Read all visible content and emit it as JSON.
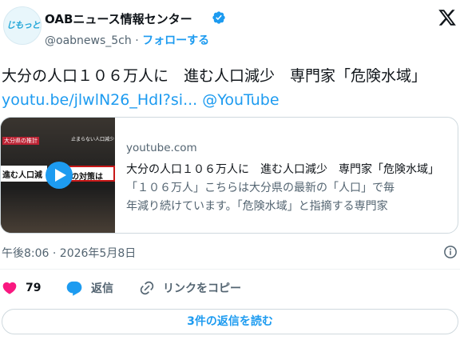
{
  "author": {
    "avatar_text": "じもっと!",
    "display_name": "OABニュース情報センター",
    "handle": "@oabnews_5ch",
    "separator": " · ",
    "follow_label": "フォローする"
  },
  "tweet": {
    "text": "大分の人口１０６万人に　進む人口減少　専門家「危険水域」",
    "link": "youtu.be/jlwlN26_HdI?si...",
    "mention": "@YouTube"
  },
  "card": {
    "thumb_banner_left": "進む人口減",
    "thumb_banner_right": "本の対策は",
    "thumb_tag": "大分県の推計",
    "thumb_tag2": "止まらない人口減少",
    "domain": "youtube.com",
    "title": "大分の人口１０６万人に　進む人口減少　専門家「危険水域」",
    "description_line1": "「１０６万人」こちらは大分県の最新の「人口」で毎",
    "description_line2": "年減り続けています。「危険水域」と指摘する専門家"
  },
  "meta": {
    "timestamp": "午後8:06 · 2026年5月8日"
  },
  "actions": {
    "like_count": "79",
    "reply_label": "返信",
    "copy_link_label": "リンクをコピー"
  },
  "replies_button": "3件の返信を読む",
  "colors": {
    "accent": "#1d9bf0",
    "like": "#f91880",
    "text": "#0f1419",
    "secondary": "#536471"
  },
  "icons": [
    "verified-badge-icon",
    "x-logo-icon",
    "play-icon",
    "info-icon",
    "heart-icon",
    "reply-bubble-icon",
    "link-icon"
  ]
}
